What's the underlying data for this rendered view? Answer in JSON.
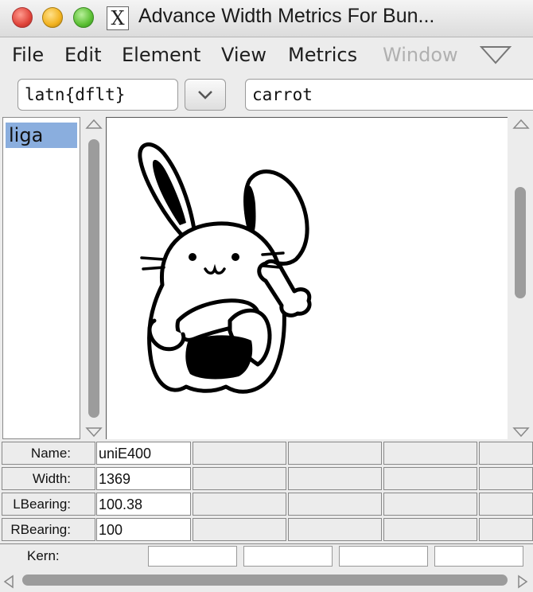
{
  "window": {
    "title": "Advance Width Metrics For Bun..."
  },
  "menu": [
    {
      "label": "File",
      "enabled": true
    },
    {
      "label": "Edit",
      "enabled": true
    },
    {
      "label": "Element",
      "enabled": true
    },
    {
      "label": "View",
      "enabled": true
    },
    {
      "label": "Metrics",
      "enabled": true
    },
    {
      "label": "Window",
      "enabled": false
    }
  ],
  "toolbar": {
    "script": "latn{dflt}",
    "text": "carrot"
  },
  "lookups": {
    "items": [
      "liga"
    ]
  },
  "metrics": {
    "name_label": "Name:",
    "name_value": "uniE400",
    "width_label": "Width:",
    "width_value": "1369",
    "lbearing_label": "LBearing:",
    "lbearing_value": "100.38",
    "rbearing_label": "RBearing:",
    "rbearing_value": "100",
    "kern_label": "Kern:"
  },
  "colors": {
    "selection": "#8aaede",
    "glyph": "#000000"
  }
}
